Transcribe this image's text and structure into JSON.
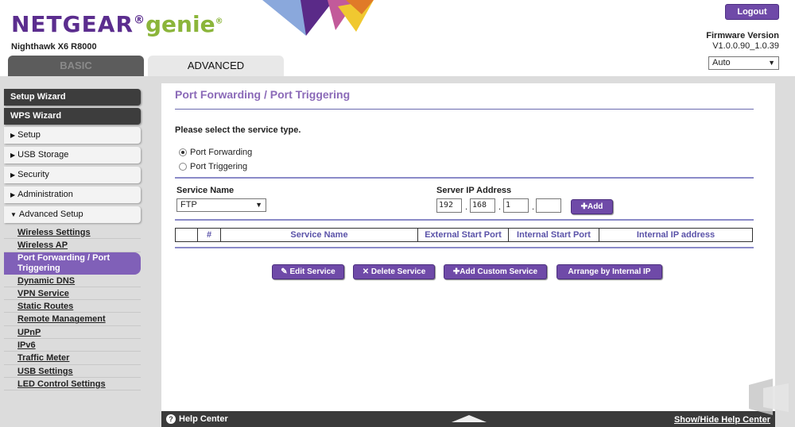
{
  "header": {
    "brand": "NETGEAR",
    "brand_suffix": "genie",
    "model": "Nighthawk X6 R8000",
    "logout_label": "Logout",
    "firmware_label": "Firmware Version",
    "firmware_value": "V1.0.0.90_1.0.39",
    "language_value": "Auto",
    "tabs": [
      {
        "label": "BASIC"
      },
      {
        "label": "ADVANCED"
      }
    ]
  },
  "sidebar": {
    "top_items": [
      {
        "label": "Setup Wizard"
      },
      {
        "label": "WPS Wizard"
      }
    ],
    "sections": [
      {
        "label": "Setup"
      },
      {
        "label": "USB Storage"
      },
      {
        "label": "Security"
      },
      {
        "label": "Administration"
      },
      {
        "label": "Advanced Setup"
      }
    ],
    "sub_items": [
      {
        "label": "Wireless Settings"
      },
      {
        "label": "Wireless AP"
      },
      {
        "label": "Port Forwarding / Port Triggering"
      },
      {
        "label": "Dynamic DNS"
      },
      {
        "label": "VPN Service"
      },
      {
        "label": "Static Routes"
      },
      {
        "label": "Remote Management"
      },
      {
        "label": "UPnP"
      },
      {
        "label": "IPv6"
      },
      {
        "label": "Traffic Meter"
      },
      {
        "label": "USB Settings"
      },
      {
        "label": "LED Control Settings"
      }
    ]
  },
  "main": {
    "title": "Port Forwarding / Port Triggering",
    "service_prompt": "Please select the service type.",
    "radio_forwarding": "Port Forwarding",
    "radio_triggering": "Port Triggering",
    "service_name_label": "Service Name",
    "service_name_value": "FTP",
    "server_ip_label": "Server IP Address",
    "ip": [
      "192",
      "168",
      "1",
      ""
    ],
    "add_label": "Add",
    "table_headers": [
      "",
      "#",
      "Service Name",
      "External Start Port",
      "Internal Start Port",
      "Internal IP address"
    ],
    "buttons": {
      "edit": "Edit Service",
      "delete": "Delete Service",
      "add_custom": "Add Custom Service",
      "arrange": "Arrange by Internal IP"
    }
  },
  "footer": {
    "help_label": "Help Center",
    "show_hide_label": "Show/Hide Help Center"
  },
  "colors": {
    "brand_purple": "#5b2d8e",
    "brand_green": "#8bb53a",
    "button_purple": "#6f4aa8",
    "title_purple": "#8b6ab8"
  }
}
